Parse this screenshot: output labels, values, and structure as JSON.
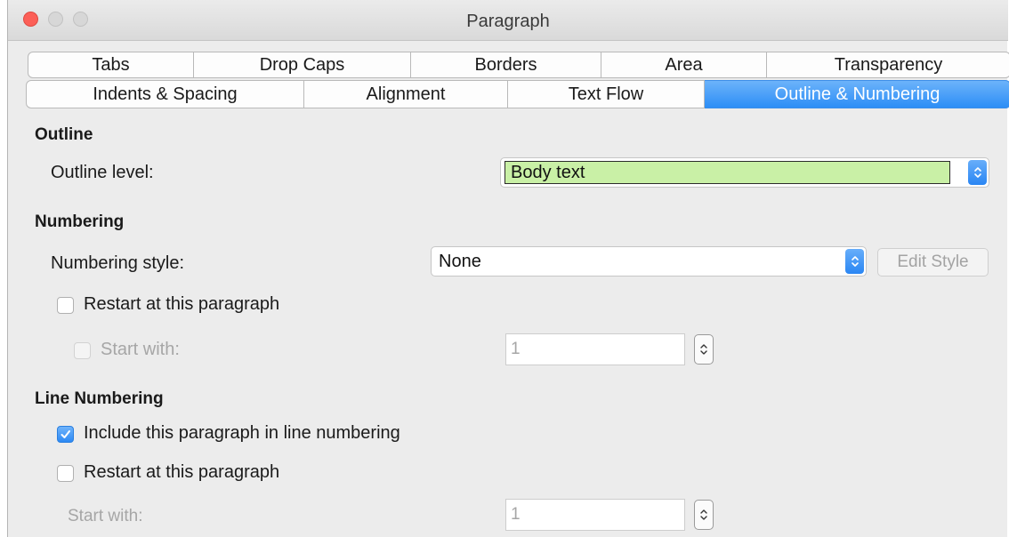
{
  "window": {
    "title": "Paragraph"
  },
  "tabs": {
    "row1": [
      "Tabs",
      "Drop Caps",
      "Borders",
      "Area",
      "Transparency"
    ],
    "row2": [
      "Indents & Spacing",
      "Alignment",
      "Text Flow",
      "Outline & Numbering"
    ],
    "active": "Outline & Numbering"
  },
  "outline": {
    "section_title": "Outline",
    "level_label": "Outline level:",
    "level_value": "Body text"
  },
  "numbering": {
    "section_title": "Numbering",
    "style_label": "Numbering style:",
    "style_value": "None",
    "edit_style_button": "Edit Style",
    "restart_label": "Restart at this paragraph",
    "restart_checked": false,
    "start_with_label": "Start with:",
    "start_with_value": "1"
  },
  "line_numbering": {
    "section_title": "Line Numbering",
    "include_label": "Include this paragraph in line numbering",
    "include_checked": true,
    "restart_label": "Restart at this paragraph",
    "restart_checked": false,
    "start_with_label": "Start with:",
    "start_with_value": "1"
  },
  "colors": {
    "accent": "#2d8ef6",
    "outline_level_highlight": "#c9f0a6",
    "close_button": "#fc5f57"
  },
  "icons": {
    "stepper": "up-down-chevron-icon",
    "check": "checkmark-icon"
  }
}
